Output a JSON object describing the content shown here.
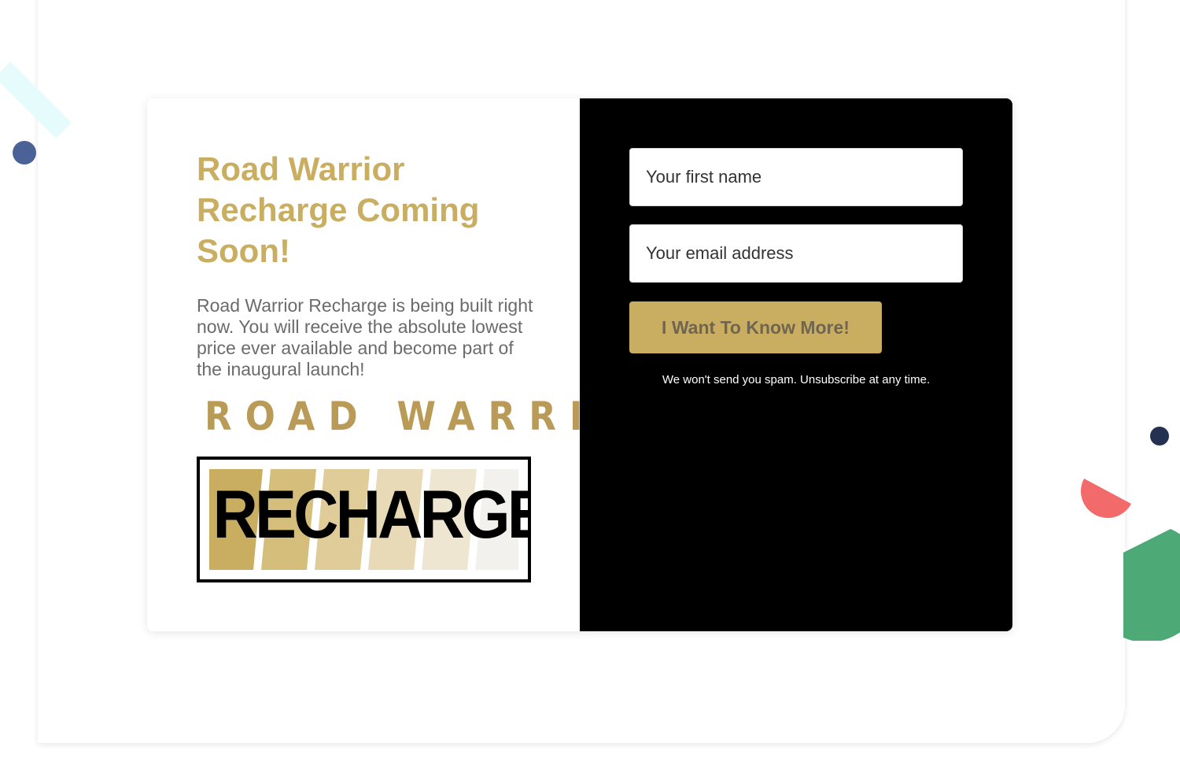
{
  "card": {
    "headline": "Road Warrior Recharge Coming Soon!",
    "description": "Road Warrior Recharge is being built right now. You will receive the absolute lowest price ever available and become part of the inaugural launch!",
    "logo": {
      "top_text": "ROAD WARRIOR",
      "main_text": "RECHARGE"
    }
  },
  "form": {
    "first_name": {
      "placeholder": "Your first name",
      "value": ""
    },
    "email": {
      "placeholder": "Your email address",
      "value": ""
    },
    "submit_label": "I Want To Know More!",
    "spam_note": "We won't send you spam. Unsubscribe at any time."
  },
  "colors": {
    "brand_gold": "#c9ae62",
    "panel_dark": "#000000",
    "text_gray": "#6b6b6b"
  }
}
